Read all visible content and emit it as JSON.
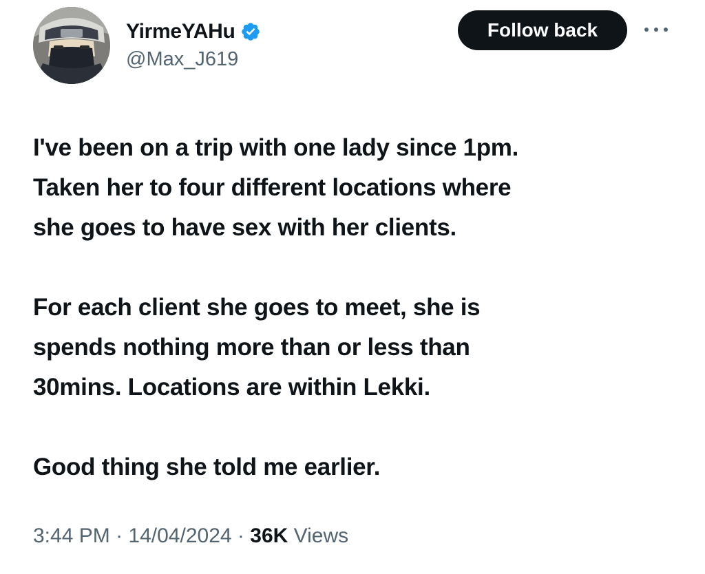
{
  "author": {
    "display_name": "YirmeYAHu",
    "handle": "@Max_J619",
    "verified": true,
    "verified_color": "#1d9bf0"
  },
  "actions": {
    "follow_label": "Follow back",
    "more_icon": "more-horizontal-icon"
  },
  "tweet": {
    "paragraphs": [
      {
        "lines": [
          "I've been on a trip with one lady since 1pm.",
          "Taken her to four different locations where",
          "she goes to have sex with her clients."
        ]
      },
      {
        "lines": [
          "For each client she goes to meet, she is",
          "spends nothing more than or less than",
          "30mins. Locations are within Lekki."
        ]
      },
      {
        "lines": [
          "Good thing she told me earlier."
        ]
      }
    ]
  },
  "meta": {
    "time": "3:44 PM",
    "separator": "·",
    "date": "14/04/2024",
    "views_count": "36K",
    "views_label": "Views"
  },
  "colors": {
    "text_primary": "#0f1419",
    "text_secondary": "#536471",
    "button_bg": "#0f1419"
  }
}
